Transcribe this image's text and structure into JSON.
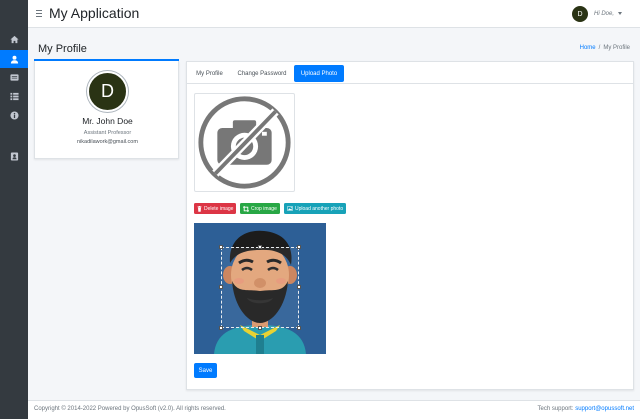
{
  "header": {
    "app_title": "My Application",
    "user_initial": "D",
    "greeting": "Hi Doe,"
  },
  "sidebar": {
    "items": [
      {
        "icon": "home-icon"
      },
      {
        "icon": "user-icon",
        "active": true
      },
      {
        "icon": "id-card-icon"
      },
      {
        "icon": "list-icon"
      },
      {
        "icon": "info-icon"
      },
      {
        "icon": "contact-book-icon"
      }
    ]
  },
  "page": {
    "title": "My Profile",
    "breadcrumb": {
      "home": "Home",
      "separator": "/",
      "current": "My Profile"
    }
  },
  "profile": {
    "initial": "D",
    "name": "Mr. John Doe",
    "role": "Assistant Professor",
    "email": "nikadilawork@gmail.com"
  },
  "tabs": [
    {
      "label": "My Profile",
      "active": false
    },
    {
      "label": "Change Password",
      "active": false
    },
    {
      "label": "Upload Photo",
      "active": true
    }
  ],
  "photo_actions": {
    "delete_label": "Delete image",
    "crop_label": "Crop image",
    "upload_label": "Upload another photo",
    "save_label": "Save"
  },
  "colors": {
    "primary": "#007bff",
    "danger": "#dc3545",
    "success": "#28a745",
    "info": "#17a2b8",
    "sidebar": "#343a40",
    "avatar": "#2a3314",
    "crop_background": "#2d5f96"
  },
  "footer": {
    "copyright": "Copyright © 2014-2022 Powered by OpusSoft (v2.0). All rights reserved.",
    "support_label": "Tech support:",
    "support_email": "support@opussoft.net"
  }
}
